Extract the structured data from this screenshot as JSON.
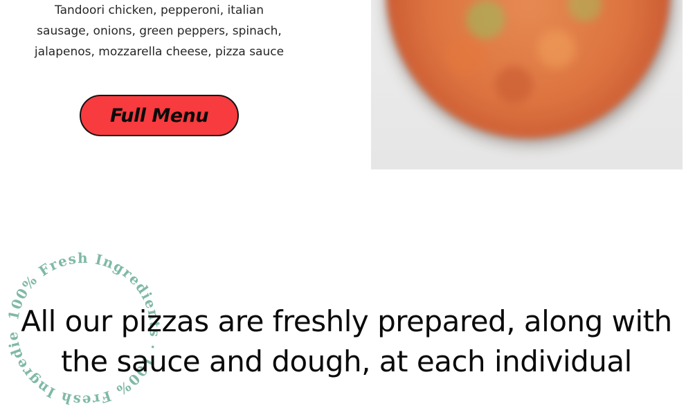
{
  "menu_item": {
    "description_lines": [
      "Tandoori chicken, pepperoni, italian",
      "sausage, onions, green peppers, spinach,",
      "jalapenos, mozzarella cheese, pizza sauce"
    ]
  },
  "full_menu_button": {
    "label": "Full Menu"
  },
  "badge": {
    "text": "100% Fresh Ingredients · 100% Fresh Ingredients · "
  },
  "headline": {
    "lines": [
      "All our pizzas are freshly prepared, along with",
      "the sauce and dough, at each individual"
    ]
  },
  "colors": {
    "button_red": "#f73b3f",
    "badge_teal": "#7fb9a6"
  }
}
